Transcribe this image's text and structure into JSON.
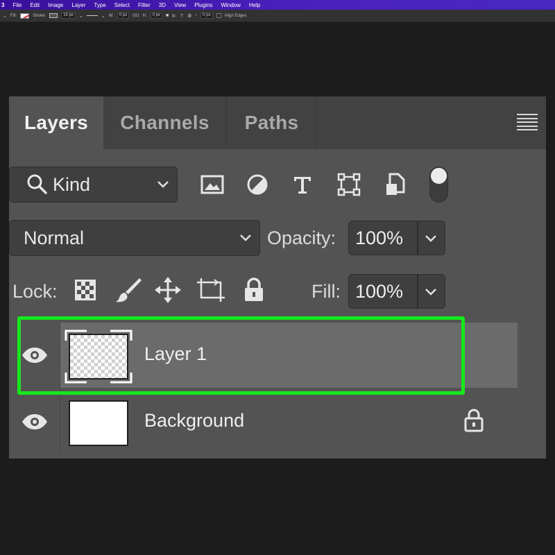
{
  "menubar": {
    "app_mark": "3",
    "items": [
      "File",
      "Edit",
      "Image",
      "Layer",
      "Type",
      "Select",
      "Filter",
      "3D",
      "View",
      "Plugins",
      "Window",
      "Help"
    ]
  },
  "options_bar": {
    "fill_label": "Fill:",
    "stroke_label": "Stroke:",
    "stroke_width": "15 px",
    "w_label": "W:",
    "w_value": "0 px",
    "link_glyph": "GO",
    "h_label": "H:",
    "h_value": "0 px",
    "radius_value": "0 px",
    "align_edges_label": "Align Edges"
  },
  "panel": {
    "tabs": [
      {
        "label": "Layers",
        "active": true
      },
      {
        "label": "Channels",
        "active": false
      },
      {
        "label": "Paths",
        "active": false
      }
    ],
    "filter": {
      "kind_label": "Kind",
      "icons": [
        "image-filter-icon",
        "adjustment-filter-icon",
        "type-filter-icon",
        "shape-filter-icon",
        "smart-object-filter-icon"
      ],
      "toggle_on": true
    },
    "blend_mode": "Normal",
    "opacity_label": "Opacity:",
    "opacity_value": "100%",
    "lock_label": "Lock:",
    "lock_icons": [
      "lock-transparent-pixels-icon",
      "lock-image-pixels-icon",
      "lock-position-icon",
      "lock-artboard-icon",
      "lock-all-icon"
    ],
    "fill_label": "Fill:",
    "fill_value": "100%",
    "layers": [
      {
        "name": "Layer 1",
        "selected": true,
        "visible": true,
        "thumbnail": "transparent",
        "locked": false
      },
      {
        "name": "Background",
        "selected": false,
        "visible": true,
        "thumbnail": "white",
        "locked": true
      }
    ]
  },
  "colors": {
    "menubar": "#4a22c0",
    "highlight": "#17e81d",
    "panel_bg": "#535353",
    "selected_row": "#6b6b6b"
  }
}
